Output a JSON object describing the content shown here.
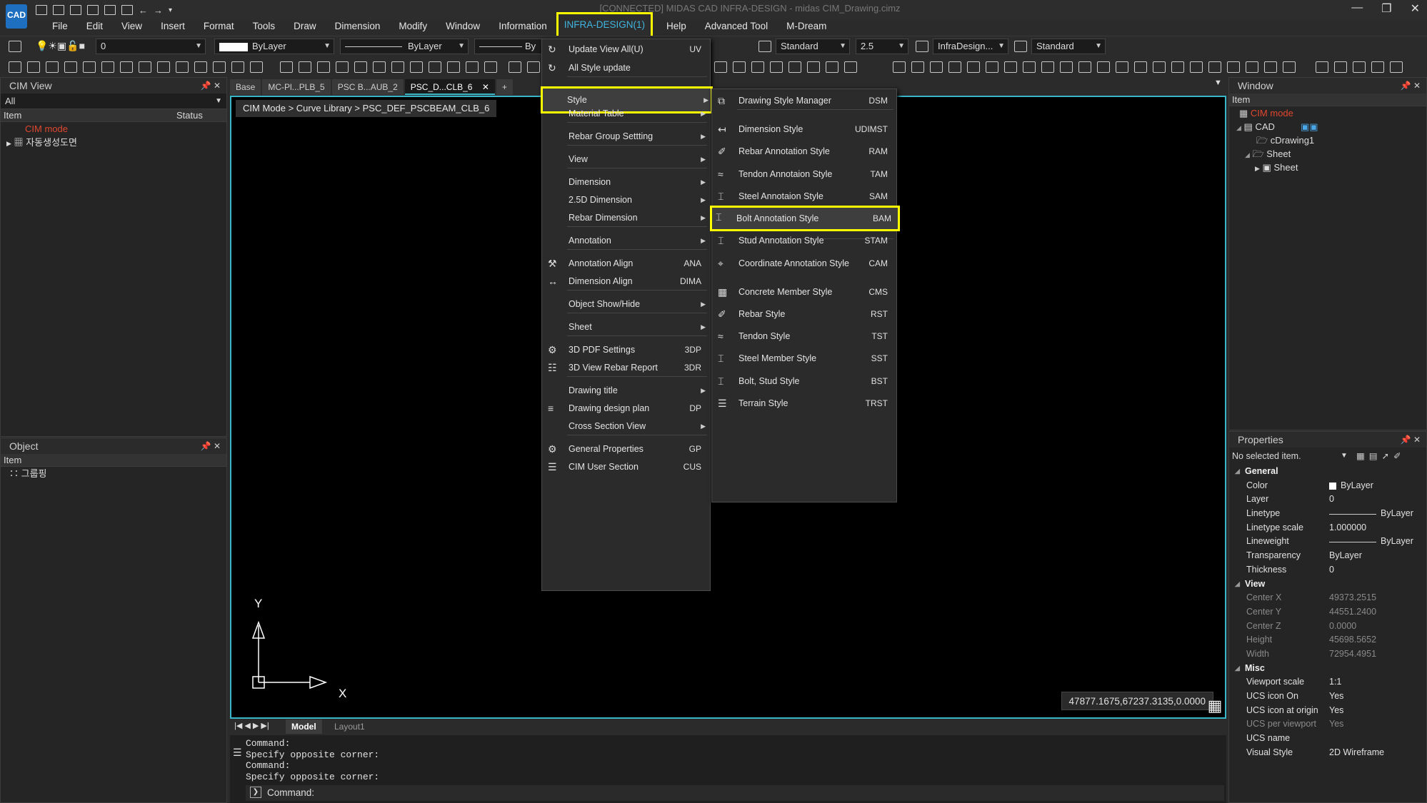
{
  "app": {
    "logo": "CAD",
    "title": "[CONNECTED] MIDAS CAD INFRA-DESIGN - midas CIM_Drawing.cimz"
  },
  "menubar": [
    "File",
    "Edit",
    "View",
    "Insert",
    "Format",
    "Tools",
    "Draw",
    "Dimension",
    "Modify",
    "Window",
    "Information",
    "INFRA-DESIGN(1)",
    "Help",
    "Advanced Tool",
    "M-Dream"
  ],
  "toolbar": {
    "layer": "0",
    "color": "ByLayer",
    "linetype": "ByLayer",
    "lineweight": "By",
    "text_style": "Standard",
    "text_height": "2.5",
    "dim_style": "InfraDesign...",
    "table_style": "Standard"
  },
  "cim_view": {
    "title": "CIM View",
    "filter": "All",
    "col_item": "Item",
    "col_status": "Status",
    "mode": "CIM mode",
    "tree_item": "자동생성도면"
  },
  "object_panel": {
    "title": "Object",
    "col_item": "Item",
    "tree_item": "그룹핑"
  },
  "doc_tabs": [
    "Base",
    "MC-Pl...PLB_5",
    "PSC B...AUB_2",
    "PSC_D...CLB_6"
  ],
  "breadcrumb": "CIM Mode > Curve Library > PSC_DEF_PSCBEAM_CLB_6",
  "coords": "47877.1675,67237.3135,0.0000",
  "ucs": {
    "y": "Y",
    "x": "X"
  },
  "layout_tabs": [
    "Model",
    "Layout1"
  ],
  "command": {
    "history": [
      "Command:",
      "Specify opposite corner:",
      "Command:",
      "Specify opposite corner:"
    ],
    "prompt": "Command:"
  },
  "infra_menu": [
    {
      "label": "Update View All(U)",
      "shortcut": "UV"
    },
    {
      "label": "All Style update",
      "shortcut": ""
    },
    {
      "label": "Style",
      "shortcut": "",
      "sub": true
    },
    {
      "label": "Material Table",
      "shortcut": "",
      "sub": true
    },
    {
      "label": "Rebar Group Settting",
      "shortcut": "",
      "sub": true
    },
    {
      "label": "View",
      "shortcut": "",
      "sub": true
    },
    {
      "label": "Dimension",
      "shortcut": "",
      "sub": true
    },
    {
      "label": "2.5D Dimension",
      "shortcut": "",
      "sub": true
    },
    {
      "label": "Rebar Dimension",
      "shortcut": "",
      "sub": true
    },
    {
      "label": "Annotation",
      "shortcut": "",
      "sub": true
    },
    {
      "label": "Annotation Align",
      "shortcut": "ANA"
    },
    {
      "label": "Dimension Align",
      "shortcut": "DIMA"
    },
    {
      "label": "Object Show/Hide",
      "shortcut": "",
      "sub": true
    },
    {
      "label": "Sheet",
      "shortcut": "",
      "sub": true
    },
    {
      "label": "3D PDF Settings",
      "shortcut": "3DP"
    },
    {
      "label": "3D View Rebar Report",
      "shortcut": "3DR"
    },
    {
      "label": "Drawing title",
      "shortcut": "",
      "sub": true
    },
    {
      "label": "Drawing design plan",
      "shortcut": "DP"
    },
    {
      "label": "Cross Section View",
      "shortcut": "",
      "sub": true
    },
    {
      "label": "General Properties",
      "shortcut": "GP"
    },
    {
      "label": "CIM User Section",
      "shortcut": "CUS"
    }
  ],
  "style_menu": [
    {
      "label": "Drawing Style Manager",
      "shortcut": "DSM"
    },
    {
      "label": "Dimension Style",
      "shortcut": "UDIMST"
    },
    {
      "label": "Rebar Annotation Style",
      "shortcut": "RAM"
    },
    {
      "label": "Tendon Annotaion Style",
      "shortcut": "TAM"
    },
    {
      "label": "Steel Annotaion Style",
      "shortcut": "SAM"
    },
    {
      "label": "Bolt Annotation Style",
      "shortcut": "BAM"
    },
    {
      "label": "Stud Annotation Style",
      "shortcut": "STAM"
    },
    {
      "label": "Coordinate Annotation Style",
      "shortcut": "CAM"
    },
    {
      "label": "Concrete Member Style",
      "shortcut": "CMS"
    },
    {
      "label": "Rebar Style",
      "shortcut": "RST"
    },
    {
      "label": "Tendon Style",
      "shortcut": "TST"
    },
    {
      "label": "Steel Member Style",
      "shortcut": "SST"
    },
    {
      "label": "Bolt, Stud Style",
      "shortcut": "BST"
    },
    {
      "label": "Terrain Style",
      "shortcut": "TRST"
    }
  ],
  "window_panel": {
    "title": "Window",
    "col_item": "Item",
    "mode": "CIM mode",
    "cad": "CAD",
    "drawing": "cDrawing1",
    "sheet_folder": "Sheet",
    "sheet": "Sheet"
  },
  "properties": {
    "title": "Properties",
    "selection": "No selected item.",
    "groups": [
      {
        "name": "General",
        "rows": [
          {
            "k": "Color",
            "v": "ByLayer"
          },
          {
            "k": "Layer",
            "v": "0"
          },
          {
            "k": "Linetype",
            "v": "ByLayer"
          },
          {
            "k": "Linetype scale",
            "v": "1.000000"
          },
          {
            "k": "Lineweight",
            "v": "ByLayer"
          },
          {
            "k": "Transparency",
            "v": "ByLayer"
          },
          {
            "k": "Thickness",
            "v": "0"
          }
        ]
      },
      {
        "name": "View",
        "rows": [
          {
            "k": "Center X",
            "v": "49373.2515"
          },
          {
            "k": "Center Y",
            "v": "44551.2400"
          },
          {
            "k": "Center Z",
            "v": "0.0000"
          },
          {
            "k": "Height",
            "v": "45698.5652"
          },
          {
            "k": "Width",
            "v": "72954.4951"
          }
        ]
      },
      {
        "name": "Misc",
        "rows": [
          {
            "k": "Viewport scale",
            "v": "1:1"
          },
          {
            "k": "UCS icon On",
            "v": "Yes"
          },
          {
            "k": "UCS icon at origin",
            "v": "Yes"
          },
          {
            "k": "UCS per viewport",
            "v": "Yes"
          },
          {
            "k": "UCS name",
            "v": ""
          },
          {
            "k": "Visual Style",
            "v": "2D Wireframe"
          }
        ]
      }
    ]
  }
}
